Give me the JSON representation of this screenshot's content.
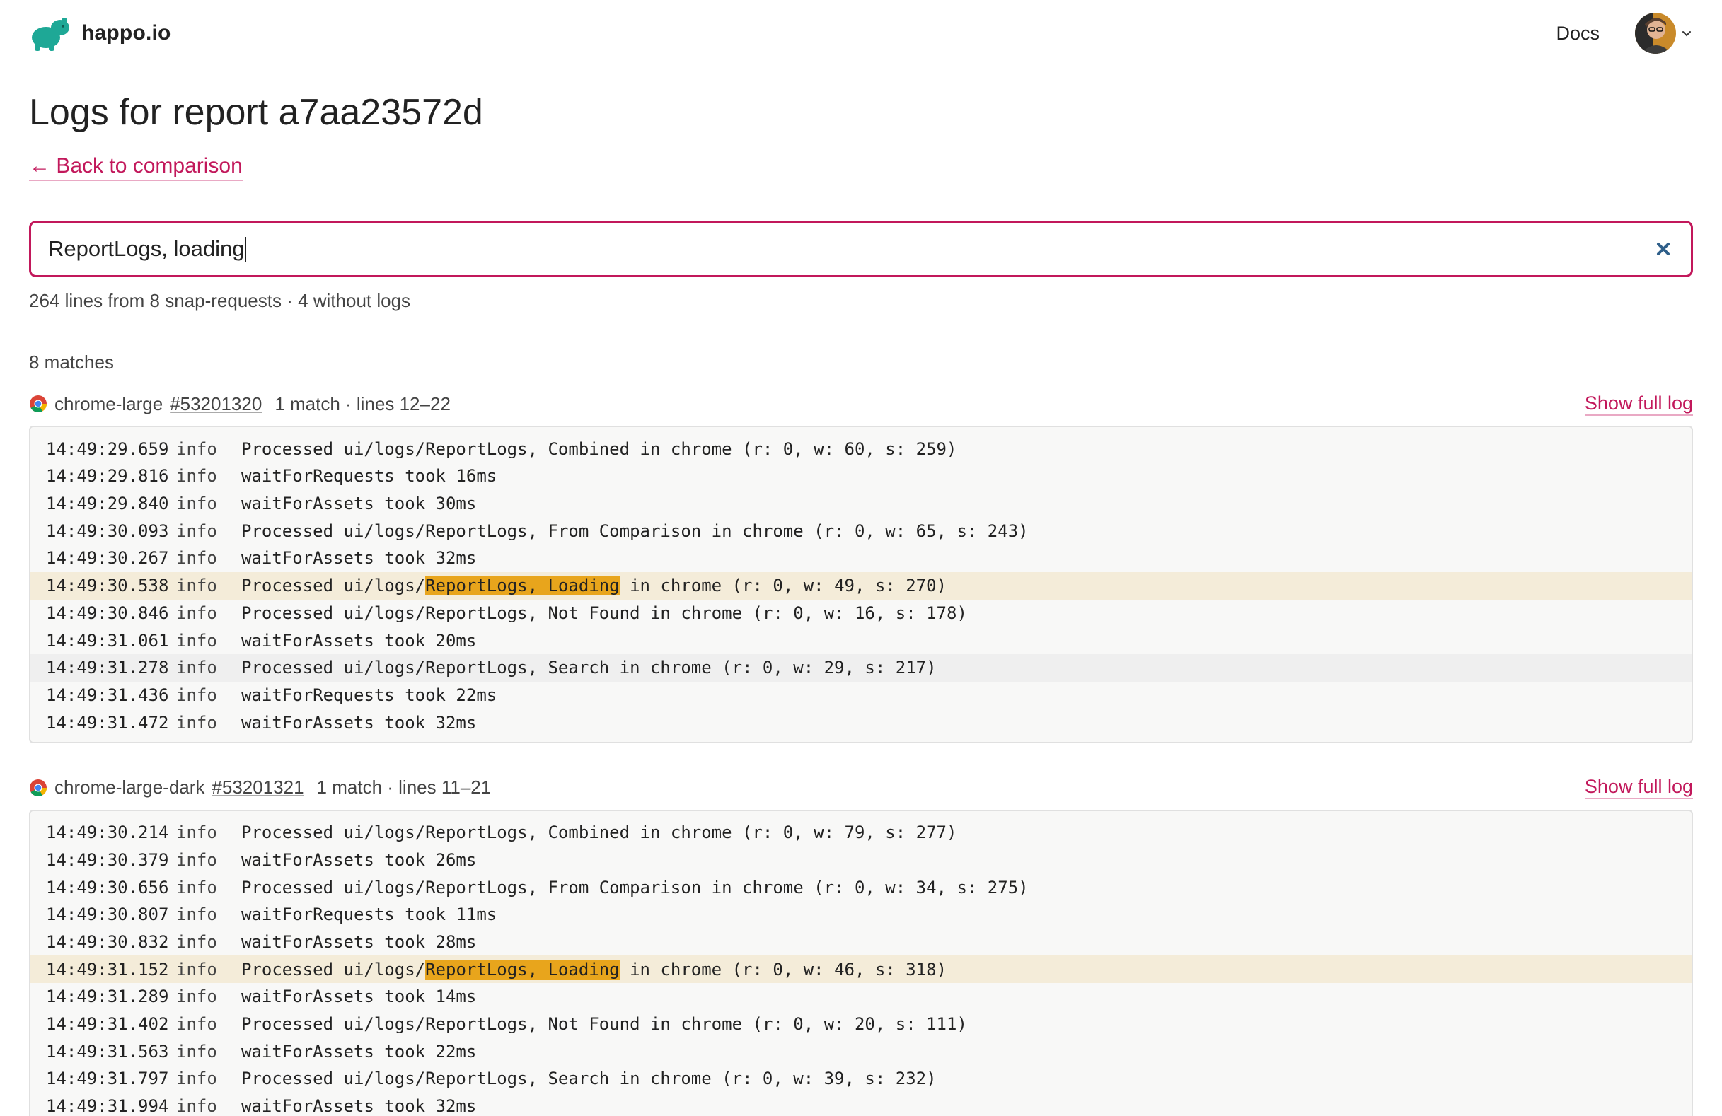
{
  "brand": {
    "name": "happo.io"
  },
  "nav": {
    "docs": "Docs"
  },
  "colors": {
    "accent": "#c2185b",
    "highlight_row": "#f4ecd9",
    "match_mark": "#e8a51c",
    "logo_green": "#1ea896"
  },
  "page": {
    "title": "Logs for report a7aa23572d",
    "back_link": "← Back to comparison"
  },
  "search": {
    "value": "ReportLogs, loading",
    "clear_icon": "close-icon"
  },
  "summary": "264 lines from 8 snap-requests · 4 without logs",
  "matches_count": "8 matches",
  "groups": [
    {
      "target": "chrome-large",
      "request": "#53201320",
      "meta": "1 match · lines 12–22",
      "full_log": "Show full log",
      "lines": [
        {
          "ts": "14:49:29.659",
          "level": "info",
          "msg": "Processed ui/logs/ReportLogs, Combined in chrome (r: 0, w: 60, s: 259)"
        },
        {
          "ts": "14:49:29.816",
          "level": "info",
          "msg": "waitForRequests took 16ms"
        },
        {
          "ts": "14:49:29.840",
          "level": "info",
          "msg": "waitForAssets took 30ms"
        },
        {
          "ts": "14:49:30.093",
          "level": "info",
          "msg": "Processed ui/logs/ReportLogs, From Comparison in chrome (r: 0, w: 65, s: 243)"
        },
        {
          "ts": "14:49:30.267",
          "level": "info",
          "msg": "waitForAssets took 32ms"
        },
        {
          "ts": "14:49:30.538",
          "level": "info",
          "pre": "Processed ui/logs/",
          "match": "ReportLogs, Loading",
          "post": " in chrome (r: 0, w: 49, s: 270)"
        },
        {
          "ts": "14:49:30.846",
          "level": "info",
          "msg": "Processed ui/logs/ReportLogs, Not Found in chrome (r: 0, w: 16, s: 178)"
        },
        {
          "ts": "14:49:31.061",
          "level": "info",
          "msg": "waitForAssets took 20ms"
        },
        {
          "ts": "14:49:31.278",
          "level": "info",
          "msg": "Processed ui/logs/ReportLogs, Search in chrome (r: 0, w: 29, s: 217)"
        },
        {
          "ts": "14:49:31.436",
          "level": "info",
          "msg": "waitForRequests took 22ms"
        },
        {
          "ts": "14:49:31.472",
          "level": "info",
          "msg": "waitForAssets took 32ms"
        }
      ]
    },
    {
      "target": "chrome-large-dark",
      "request": "#53201321",
      "meta": "1 match · lines 11–21",
      "full_log": "Show full log",
      "lines": [
        {
          "ts": "14:49:30.214",
          "level": "info",
          "msg": "Processed ui/logs/ReportLogs, Combined in chrome (r: 0, w: 79, s: 277)"
        },
        {
          "ts": "14:49:30.379",
          "level": "info",
          "msg": "waitForAssets took 26ms"
        },
        {
          "ts": "14:49:30.656",
          "level": "info",
          "msg": "Processed ui/logs/ReportLogs, From Comparison in chrome (r: 0, w: 34, s: 275)"
        },
        {
          "ts": "14:49:30.807",
          "level": "info",
          "msg": "waitForRequests took 11ms"
        },
        {
          "ts": "14:49:30.832",
          "level": "info",
          "msg": "waitForAssets took 28ms"
        },
        {
          "ts": "14:49:31.152",
          "level": "info",
          "pre": "Processed ui/logs/",
          "match": "ReportLogs, Loading",
          "post": " in chrome (r: 0, w: 46, s: 318)"
        },
        {
          "ts": "14:49:31.289",
          "level": "info",
          "msg": "waitForAssets took 14ms"
        },
        {
          "ts": "14:49:31.402",
          "level": "info",
          "msg": "Processed ui/logs/ReportLogs, Not Found in chrome (r: 0, w: 20, s: 111)"
        },
        {
          "ts": "14:49:31.563",
          "level": "info",
          "msg": "waitForAssets took 22ms"
        },
        {
          "ts": "14:49:31.797",
          "level": "info",
          "msg": "Processed ui/logs/ReportLogs, Search in chrome (r: 0, w: 39, s: 232)"
        },
        {
          "ts": "14:49:31.994",
          "level": "info",
          "msg": "waitForAssets took 32ms"
        }
      ]
    }
  ]
}
